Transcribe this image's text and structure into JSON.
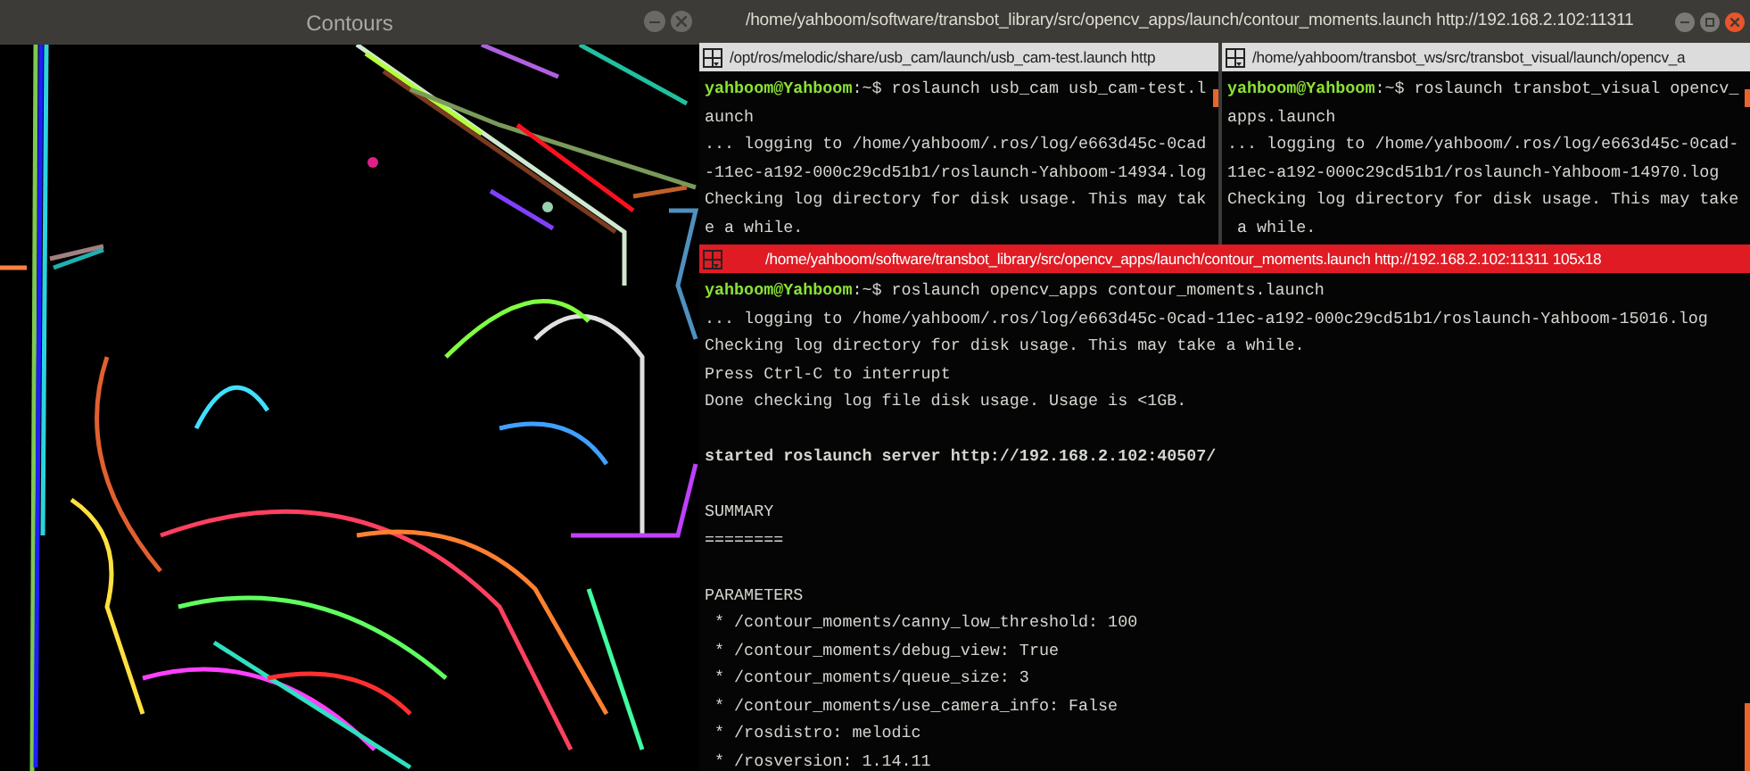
{
  "image_window": {
    "title": "Contours"
  },
  "terminal_window": {
    "title": "/home/yahboom/software/transbot_library/src/opencv_apps/launch/contour_moments.launch http://192.168.2.102:11311"
  },
  "panes": [
    {
      "title": "/opt/ros/melodic/share/usb_cam/launch/usb_cam-test.launch http",
      "focused": false,
      "lines": [
        {
          "kind": "prompt",
          "user": "yahboom@Yahboom",
          "path": ":~$ ",
          "text": "roslaunch usb_cam usb_cam-test.l"
        },
        {
          "kind": "text",
          "text": "aunch"
        },
        {
          "kind": "text",
          "text": "... logging to /home/yahboom/.ros/log/e663d45c-0cad"
        },
        {
          "kind": "text",
          "text": "-11ec-a192-000c29cd51b1/roslaunch-Yahboom-14934.log"
        },
        {
          "kind": "text",
          "text": "Checking log directory for disk usage. This may tak"
        },
        {
          "kind": "text",
          "text": "e a while."
        }
      ]
    },
    {
      "title": "/home/yahboom/transbot_ws/src/transbot_visual/launch/opencv_a",
      "focused": false,
      "lines": [
        {
          "kind": "prompt",
          "user": "yahboom@Yahboom",
          "path": ":~$ ",
          "text": "roslaunch transbot_visual opencv_"
        },
        {
          "kind": "text",
          "text": "apps.launch"
        },
        {
          "kind": "text",
          "text": "... logging to /home/yahboom/.ros/log/e663d45c-0cad-"
        },
        {
          "kind": "text",
          "text": "11ec-a192-000c29cd51b1/roslaunch-Yahboom-14970.log"
        },
        {
          "kind": "text",
          "text": "Checking log directory for disk usage. This may take"
        },
        {
          "kind": "text",
          "text": " a while."
        }
      ]
    },
    {
      "title": "/home/yahboom/software/transbot_library/src/opencv_apps/launch/contour_moments.launch http://192.168.2.102:11311 105x18",
      "focused": true,
      "lines": [
        {
          "kind": "prompt",
          "user": "yahboom@Yahboom",
          "path": ":~$ ",
          "text": "roslaunch opencv_apps contour_moments.launch"
        },
        {
          "kind": "text",
          "text": "... logging to /home/yahboom/.ros/log/e663d45c-0cad-11ec-a192-000c29cd51b1/roslaunch-Yahboom-15016.log"
        },
        {
          "kind": "text",
          "text": "Checking log directory for disk usage. This may take a while."
        },
        {
          "kind": "text",
          "text": "Press Ctrl-C to interrupt"
        },
        {
          "kind": "text",
          "text": "Done checking log file disk usage. Usage is <1GB."
        },
        {
          "kind": "blank"
        },
        {
          "kind": "bold",
          "text": "started roslaunch server http://192.168.2.102:40507/"
        },
        {
          "kind": "blank"
        },
        {
          "kind": "text",
          "text": "SUMMARY"
        },
        {
          "kind": "text",
          "text": "========"
        },
        {
          "kind": "blank"
        },
        {
          "kind": "text",
          "text": "PARAMETERS"
        },
        {
          "kind": "text",
          "text": " * /contour_moments/canny_low_threshold: 100"
        },
        {
          "kind": "text",
          "text": " * /contour_moments/debug_view: True"
        },
        {
          "kind": "text",
          "text": " * /contour_moments/queue_size: 3"
        },
        {
          "kind": "text",
          "text": " * /contour_moments/use_camera_info: False"
        },
        {
          "kind": "text",
          "text": " * /rosdistro: melodic"
        },
        {
          "kind": "text",
          "text": " * /rosversion: 1.14.11"
        }
      ]
    }
  ]
}
